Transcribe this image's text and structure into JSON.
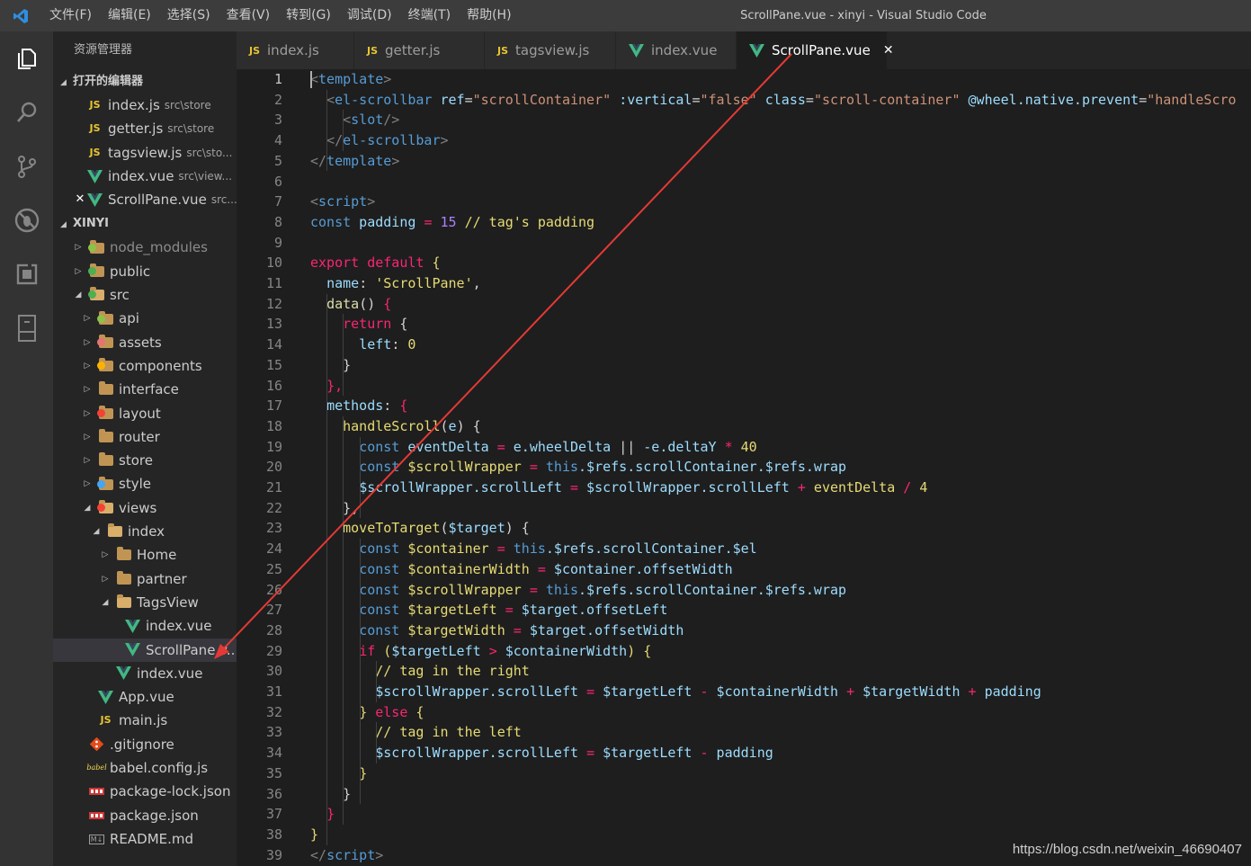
{
  "window": {
    "title": "ScrollPane.vue - xinyi - Visual Studio Code",
    "menu": [
      "文件(F)",
      "编辑(E)",
      "选择(S)",
      "查看(V)",
      "转到(G)",
      "调试(D)",
      "终端(T)",
      "帮助(H)"
    ]
  },
  "sidebar": {
    "title": "资源管理器",
    "open_editors_header": "打开的编辑器",
    "open_editors": [
      {
        "name": "index.js",
        "desc": "src\\store",
        "type": "js"
      },
      {
        "name": "getter.js",
        "desc": "src\\store",
        "type": "js"
      },
      {
        "name": "tagsview.js",
        "desc": "src\\sto...",
        "type": "js"
      },
      {
        "name": "index.vue",
        "desc": "src\\view...",
        "type": "vue"
      },
      {
        "name": "ScrollPane.vue",
        "desc": "src...",
        "type": "vue",
        "active": true
      }
    ],
    "project_header": "XINYI",
    "tree": [
      {
        "name": "node_modules",
        "type": "folder",
        "depth": 0,
        "expanded": false,
        "badge": "#8bc34a",
        "dim": true
      },
      {
        "name": "public",
        "type": "folder",
        "depth": 0,
        "expanded": false,
        "badge": "#4caf50"
      },
      {
        "name": "src",
        "type": "folder",
        "depth": 0,
        "expanded": true,
        "badge": "#4caf50"
      },
      {
        "name": "api",
        "type": "folder",
        "depth": 1,
        "expanded": false,
        "badge": "#8bc34a"
      },
      {
        "name": "assets",
        "type": "folder",
        "depth": 1,
        "expanded": false,
        "badge": "#e57373"
      },
      {
        "name": "components",
        "type": "folder",
        "depth": 1,
        "expanded": false,
        "badge": "#ffb300"
      },
      {
        "name": "interface",
        "type": "folder",
        "depth": 1,
        "expanded": false
      },
      {
        "name": "layout",
        "type": "folder",
        "depth": 1,
        "expanded": false,
        "badge": "#f44336"
      },
      {
        "name": "router",
        "type": "folder",
        "depth": 1,
        "expanded": false
      },
      {
        "name": "store",
        "type": "folder",
        "depth": 1,
        "expanded": false
      },
      {
        "name": "style",
        "type": "folder",
        "depth": 1,
        "expanded": false,
        "badge": "#42a5f5"
      },
      {
        "name": "views",
        "type": "folder",
        "depth": 1,
        "expanded": true,
        "badge": "#f44336"
      },
      {
        "name": "index",
        "type": "folder",
        "depth": 2,
        "expanded": true
      },
      {
        "name": "Home",
        "type": "folder",
        "depth": 3,
        "expanded": false
      },
      {
        "name": "partner",
        "type": "folder",
        "depth": 3,
        "expanded": false
      },
      {
        "name": "TagsView",
        "type": "folder",
        "depth": 3,
        "expanded": true
      },
      {
        "name": "index.vue",
        "type": "vue",
        "depth": 4
      },
      {
        "name": "ScrollPane.v...",
        "type": "vue",
        "depth": 4,
        "selected": true
      },
      {
        "name": "index.vue",
        "type": "vue",
        "depth": 3
      },
      {
        "name": "App.vue",
        "type": "vue",
        "depth": 1
      },
      {
        "name": "main.js",
        "type": "js",
        "depth": 1
      },
      {
        "name": ".gitignore",
        "type": "git",
        "depth": 0
      },
      {
        "name": "babel.config.js",
        "type": "babel",
        "depth": 0
      },
      {
        "name": "package-lock.json",
        "type": "npm",
        "depth": 0
      },
      {
        "name": "package.json",
        "type": "npm",
        "depth": 0
      },
      {
        "name": "README.md",
        "type": "md",
        "depth": 0
      }
    ]
  },
  "tabs": [
    {
      "name": "index.js",
      "type": "js"
    },
    {
      "name": "getter.js",
      "type": "js"
    },
    {
      "name": "tagsview.js",
      "type": "js"
    },
    {
      "name": "index.vue",
      "type": "vue"
    },
    {
      "name": "ScrollPane.vue",
      "type": "vue",
      "active": true
    }
  ],
  "editor": {
    "current_line": 1,
    "lines": [
      [
        [
          "<",
          "punc"
        ],
        [
          "template",
          "tag"
        ],
        [
          ">",
          "punc"
        ]
      ],
      [
        [
          "  ",
          "txt"
        ],
        [
          "<",
          "punc"
        ],
        [
          "el-scrollbar",
          "tag"
        ],
        [
          " ",
          "txt"
        ],
        [
          "ref",
          "attr"
        ],
        [
          "=",
          "txt"
        ],
        [
          "\"scrollContainer\"",
          "str"
        ],
        [
          " ",
          "txt"
        ],
        [
          ":vertical",
          "attr"
        ],
        [
          "=",
          "txt"
        ],
        [
          "\"false\"",
          "str"
        ],
        [
          " ",
          "txt"
        ],
        [
          "class",
          "attr"
        ],
        [
          "=",
          "txt"
        ],
        [
          "\"scroll-container\"",
          "str"
        ],
        [
          " ",
          "txt"
        ],
        [
          "@wheel",
          "attr"
        ],
        [
          ".native.prevent",
          "attr"
        ],
        [
          "=",
          "txt"
        ],
        [
          "\"handleScro",
          "str"
        ]
      ],
      [
        [
          "    ",
          "txt"
        ],
        [
          "<",
          "punc"
        ],
        [
          "slot",
          "tag"
        ],
        [
          "/>",
          "punc"
        ]
      ],
      [
        [
          "  ",
          "txt"
        ],
        [
          "</",
          "punc"
        ],
        [
          "el-scrollbar",
          "tag"
        ],
        [
          ">",
          "punc"
        ]
      ],
      [
        [
          "</",
          "punc"
        ],
        [
          "template",
          "tag"
        ],
        [
          ">",
          "punc"
        ]
      ],
      [],
      [
        [
          "<",
          "punc"
        ],
        [
          "script",
          "tag"
        ],
        [
          ">",
          "punc"
        ]
      ],
      [
        [
          "const",
          "kw2"
        ],
        [
          " padding ",
          "attr"
        ],
        [
          "=",
          "op"
        ],
        [
          " ",
          "txt"
        ],
        [
          "15",
          "num"
        ],
        [
          " ",
          "txt"
        ],
        [
          "// tag's padding",
          "str2"
        ]
      ],
      [],
      [
        [
          "export",
          "kw"
        ],
        [
          " ",
          "txt"
        ],
        [
          "default",
          "kw"
        ],
        [
          " {",
          "str2"
        ]
      ],
      [
        [
          "  ",
          "txt"
        ],
        [
          "name",
          "attr"
        ],
        [
          ": ",
          "txt"
        ],
        [
          "'ScrollPane'",
          "str2"
        ],
        [
          ",",
          "txt"
        ]
      ],
      [
        [
          "  ",
          "txt"
        ],
        [
          "data",
          "fn"
        ],
        [
          "() ",
          "txt"
        ],
        [
          "{",
          "kw"
        ]
      ],
      [
        [
          "    ",
          "txt"
        ],
        [
          "return",
          "kw"
        ],
        [
          " {",
          "txt"
        ]
      ],
      [
        [
          "      ",
          "txt"
        ],
        [
          "left",
          "attr"
        ],
        [
          ": ",
          "txt"
        ],
        [
          "0",
          "str2"
        ]
      ],
      [
        [
          "    ",
          "txt"
        ],
        [
          "}",
          "txt"
        ]
      ],
      [
        [
          "  ",
          "txt"
        ],
        [
          "},",
          "kw"
        ]
      ],
      [
        [
          "  ",
          "txt"
        ],
        [
          "methods",
          "attr"
        ],
        [
          ": ",
          "txt"
        ],
        [
          "{",
          "kw"
        ]
      ],
      [
        [
          "    ",
          "txt"
        ],
        [
          "handleScroll",
          "str2"
        ],
        [
          "(",
          "txt"
        ],
        [
          "e",
          "attr"
        ],
        [
          ") {",
          "txt"
        ]
      ],
      [
        [
          "      ",
          "txt"
        ],
        [
          "const",
          "kw2"
        ],
        [
          " eventDelta ",
          "attr"
        ],
        [
          "=",
          "op"
        ],
        [
          " e.wheelDelta ",
          "attr"
        ],
        [
          "||",
          "txt"
        ],
        [
          " -e.deltaY ",
          "attr"
        ],
        [
          "*",
          "op"
        ],
        [
          " ",
          "txt"
        ],
        [
          "40",
          "str2"
        ]
      ],
      [
        [
          "      ",
          "txt"
        ],
        [
          "const",
          "kw2"
        ],
        [
          " $scrollWrapper ",
          "str2"
        ],
        [
          "=",
          "op"
        ],
        [
          " ",
          "txt"
        ],
        [
          "this",
          "kw2"
        ],
        [
          ".$refs.scrollContainer.$refs.wrap",
          "attr"
        ]
      ],
      [
        [
          "      ",
          "txt"
        ],
        [
          "$scrollWrapper.scrollLeft ",
          "attr"
        ],
        [
          "=",
          "op"
        ],
        [
          " $scrollWrapper.scrollLeft ",
          "attr"
        ],
        [
          "+",
          "op"
        ],
        [
          " eventDelta ",
          "str2"
        ],
        [
          "/",
          "op"
        ],
        [
          " ",
          "txt"
        ],
        [
          "4",
          "str2"
        ]
      ],
      [
        [
          "    ",
          "txt"
        ],
        [
          "},",
          "txt"
        ]
      ],
      [
        [
          "    ",
          "txt"
        ],
        [
          "moveToTarget",
          "str2"
        ],
        [
          "(",
          "txt"
        ],
        [
          "$target",
          "attr"
        ],
        [
          ") {",
          "txt"
        ]
      ],
      [
        [
          "      ",
          "txt"
        ],
        [
          "const",
          "kw2"
        ],
        [
          " $container ",
          "str2"
        ],
        [
          "=",
          "op"
        ],
        [
          " ",
          "txt"
        ],
        [
          "this",
          "kw2"
        ],
        [
          ".$refs.scrollContainer.$el",
          "attr"
        ]
      ],
      [
        [
          "      ",
          "txt"
        ],
        [
          "const",
          "kw2"
        ],
        [
          " $containerWidth ",
          "str2"
        ],
        [
          "=",
          "op"
        ],
        [
          " $container.offsetWidth",
          "attr"
        ]
      ],
      [
        [
          "      ",
          "txt"
        ],
        [
          "const",
          "kw2"
        ],
        [
          " $scrollWrapper ",
          "str2"
        ],
        [
          "=",
          "op"
        ],
        [
          " ",
          "txt"
        ],
        [
          "this",
          "kw2"
        ],
        [
          ".$refs.scrollContainer.$refs.wrap",
          "attr"
        ]
      ],
      [
        [
          "      ",
          "txt"
        ],
        [
          "const",
          "kw2"
        ],
        [
          " $targetLeft ",
          "str2"
        ],
        [
          "=",
          "op"
        ],
        [
          " $target.offsetLeft",
          "attr"
        ]
      ],
      [
        [
          "      ",
          "txt"
        ],
        [
          "const",
          "kw2"
        ],
        [
          " $targetWidth ",
          "str2"
        ],
        [
          "=",
          "op"
        ],
        [
          " $target.offsetWidth",
          "attr"
        ]
      ],
      [
        [
          "      ",
          "txt"
        ],
        [
          "if",
          "kw"
        ],
        [
          " (",
          "str2"
        ],
        [
          "$targetLeft ",
          "attr"
        ],
        [
          ">",
          "op"
        ],
        [
          " $containerWidth",
          "attr"
        ],
        [
          ") {",
          "str2"
        ]
      ],
      [
        [
          "        ",
          "txt"
        ],
        [
          "// tag in the right",
          "str2"
        ]
      ],
      [
        [
          "        ",
          "txt"
        ],
        [
          "$scrollWrapper.scrollLeft ",
          "attr"
        ],
        [
          "=",
          "op"
        ],
        [
          " $targetLeft ",
          "attr"
        ],
        [
          "-",
          "op"
        ],
        [
          " $containerWidth ",
          "attr"
        ],
        [
          "+",
          "op"
        ],
        [
          " $targetWidth ",
          "attr"
        ],
        [
          "+",
          "op"
        ],
        [
          " padding",
          "attr"
        ]
      ],
      [
        [
          "      ",
          "txt"
        ],
        [
          "}",
          "str2"
        ],
        [
          " ",
          "txt"
        ],
        [
          "else",
          "kw"
        ],
        [
          " {",
          "str2"
        ]
      ],
      [
        [
          "        ",
          "txt"
        ],
        [
          "// tag in the left",
          "str2"
        ]
      ],
      [
        [
          "        ",
          "txt"
        ],
        [
          "$scrollWrapper.scrollLeft ",
          "attr"
        ],
        [
          "=",
          "op"
        ],
        [
          " $targetLeft ",
          "attr"
        ],
        [
          "-",
          "op"
        ],
        [
          " padding",
          "attr"
        ]
      ],
      [
        [
          "      ",
          "txt"
        ],
        [
          "}",
          "str2"
        ]
      ],
      [
        [
          "    ",
          "txt"
        ],
        [
          "}",
          "txt"
        ]
      ],
      [
        [
          "  ",
          "txt"
        ],
        [
          "}",
          "kw"
        ]
      ],
      [
        [
          "}",
          "str2"
        ]
      ],
      [
        [
          "</",
          "punc"
        ],
        [
          "script",
          "tag"
        ],
        [
          ">",
          "punc"
        ]
      ]
    ]
  },
  "watermark": "https://blog.csdn.net/weixin_46690407",
  "colors": {
    "accent": "#007acc",
    "annotation_arrow": "#e53935"
  },
  "activity_icons": [
    "explorer-icon",
    "search-icon",
    "source-control-icon",
    "debug-icon",
    "extensions-icon",
    "panel-icon"
  ]
}
